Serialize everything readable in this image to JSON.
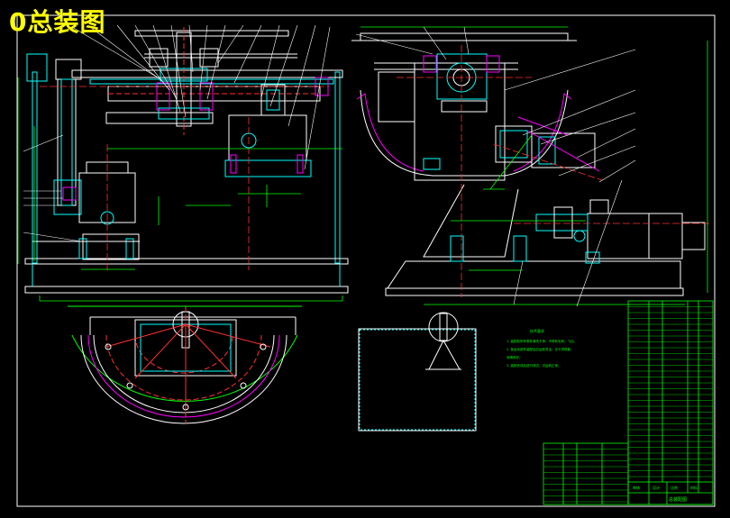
{
  "drawing": {
    "title": "0总装图",
    "colors": {
      "background": "#000000",
      "outline": "#ffffff",
      "part_line": "#00ffff",
      "dimension": "#00ff00",
      "center_line": "#ff3030",
      "section_line": "#ff00ff",
      "table_line": "#00ff00",
      "title_text": "#ffff00"
    }
  },
  "tech_notes": {
    "heading": "技术要求",
    "lines": [
      "1. 装配前所有零件清洗干净，不得有毛刺、飞边。",
      "2. 各运动部件装配后应运转灵活，无卡滞现象，",
      "   润滑良好。",
      "3. 装配完成后进行调试，试运转正常。"
    ]
  },
  "title_block": {
    "cells": [
      "审核",
      "设计",
      "比例",
      "材料",
      "总装配图"
    ]
  }
}
